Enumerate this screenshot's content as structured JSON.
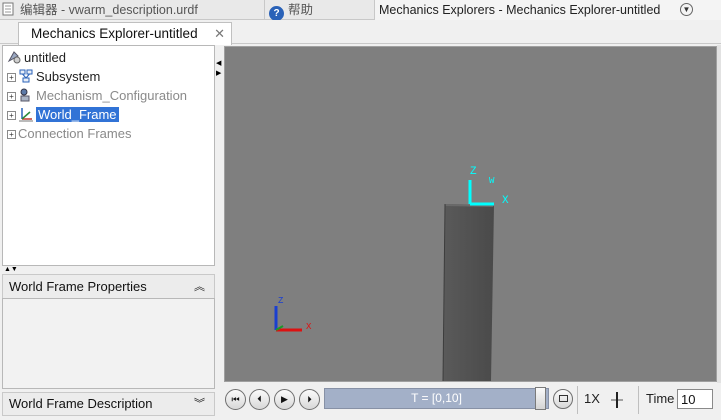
{
  "top_tabs": [
    {
      "label": "编辑器 - vwarm_description.urdf",
      "icon": "editor-icon"
    },
    {
      "label": "帮助",
      "icon": "help-icon"
    },
    {
      "label": "Mechanics Explorers - Mechanics Explorer-untitled",
      "icon": "panel-menu-icon"
    }
  ],
  "doc_tab": {
    "label": "Mechanics Explorer-untitled",
    "close": "✕"
  },
  "tree": {
    "root": "untitled",
    "items": [
      {
        "label": "Subsystem",
        "greyed": false,
        "selected": false
      },
      {
        "label": "Mechanism_Configuration",
        "greyed": true,
        "selected": false
      },
      {
        "label": "World_Frame",
        "greyed": false,
        "selected": true
      },
      {
        "label": "Connection Frames",
        "greyed": true,
        "selected": false
      }
    ]
  },
  "properties_panel": {
    "title": "World Frame Properties",
    "chevron": "⌃"
  },
  "description_panel": {
    "title": "World Frame Description",
    "chevron": "⌄"
  },
  "viewport": {
    "background": "#7f7f7f",
    "main_axes": {
      "labels": [
        "Z",
        "W",
        "X"
      ],
      "color": "#00ffff"
    },
    "triad_axes": {
      "labels": [
        "Z",
        "X"
      ]
    }
  },
  "playback": {
    "timeline_label": "T = [0,10]",
    "speed_label": "1X",
    "time_label": "Time",
    "time_value": "10"
  },
  "colors": {
    "selection": "#3173d6",
    "axis": "#00ffff",
    "timeline": "#a3b0c8"
  }
}
